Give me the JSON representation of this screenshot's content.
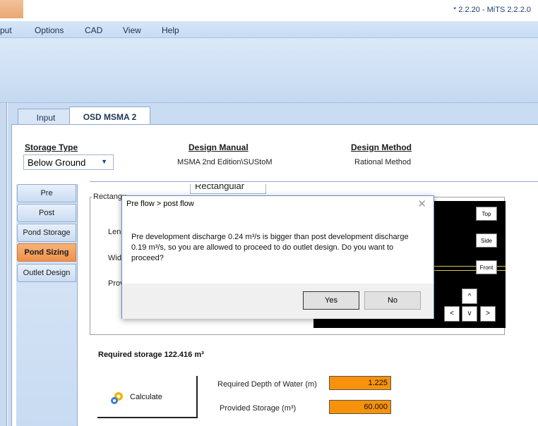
{
  "window": {
    "version": "* 2.2.20 - MiTS 2.2.2.0"
  },
  "menu": [
    "put",
    "Options",
    "CAD",
    "View",
    "Help"
  ],
  "tabs": {
    "input": "Input",
    "osd": "OSD MSMA 2"
  },
  "headers": {
    "storage_type": "Storage Type",
    "design_manual": "Design Manual",
    "design_method": "Design Method",
    "design_manual_value": "MSMA 2nd Edition\\SUStoM",
    "design_method_value": "Rational Method",
    "storage_type_value": "Below Ground"
  },
  "side_tabs": [
    "Pre",
    "Post",
    "Pond Storage",
    "Pond Sizing",
    "Outlet Design"
  ],
  "active_side_tab": "Pond Sizing",
  "form": {
    "shape_value": "Rectangular",
    "group_label": "Rectangu",
    "field_length": "Leng",
    "field_width": "Widt",
    "field_prov": "Prov"
  },
  "view_buttons": {
    "top": "Top",
    "side": "Side",
    "front": "Front",
    "up": "^",
    "left": "<",
    "down": "v",
    "right": ">"
  },
  "results": {
    "required_storage": "Required storage 122.416 m³",
    "calculate_label": "Calculate",
    "depth_label": "Required Depth of Water (m)",
    "depth_value": "1.225",
    "provided_label": "Provided Storage (m³)",
    "provided_value": "60.000"
  },
  "dialog": {
    "title": "Pre flow > post flow",
    "message": "Pre development discharge 0.24 m³/s is bigger than post development discharge 0.19  m³/s, so you are allowed to proceed to do outlet design. Do you want to proceed?",
    "yes": "Yes",
    "no": "No"
  },
  "colors": {
    "accent_orange": "#f7920a",
    "active_tab": "#f0924a",
    "ribbon": "#cfe0f4"
  }
}
